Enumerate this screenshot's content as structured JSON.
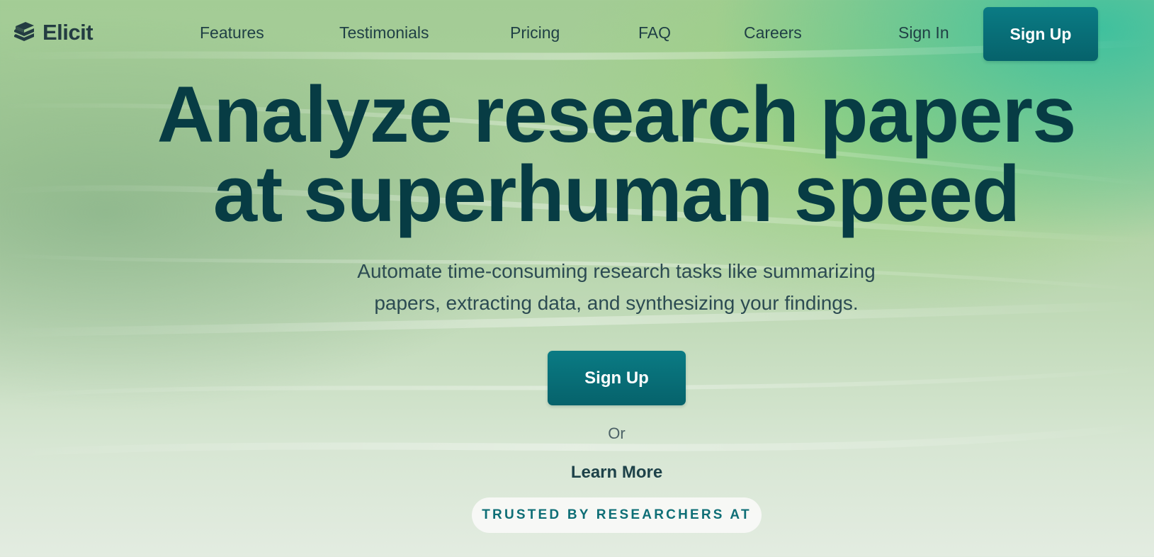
{
  "brand": {
    "name": "Elicit",
    "logo_icon": "stacked-layers-icon"
  },
  "nav": {
    "links": [
      {
        "label": "Features"
      },
      {
        "label": "Testimonials"
      },
      {
        "label": "Pricing"
      },
      {
        "label": "FAQ"
      },
      {
        "label": "Careers"
      }
    ],
    "sign_in": "Sign In",
    "sign_up": "Sign Up"
  },
  "hero": {
    "title_line1": "Analyze research papers",
    "title_line2": "at superhuman speed",
    "subtitle_line1": "Automate time-consuming research tasks like summarizing",
    "subtitle_line2": "papers, extracting data, and synthesizing your findings.",
    "cta_label": "Sign Up",
    "or_label": "Or",
    "learn_more_label": "Learn More",
    "trusted_label": "TRUSTED BY RESEARCHERS AT"
  },
  "colors": {
    "primary_button": "#06727b",
    "heading": "#073c44",
    "body_text": "#2c4b52",
    "background_top_right": "#2ebea0",
    "background_base": "#a3cc95"
  }
}
